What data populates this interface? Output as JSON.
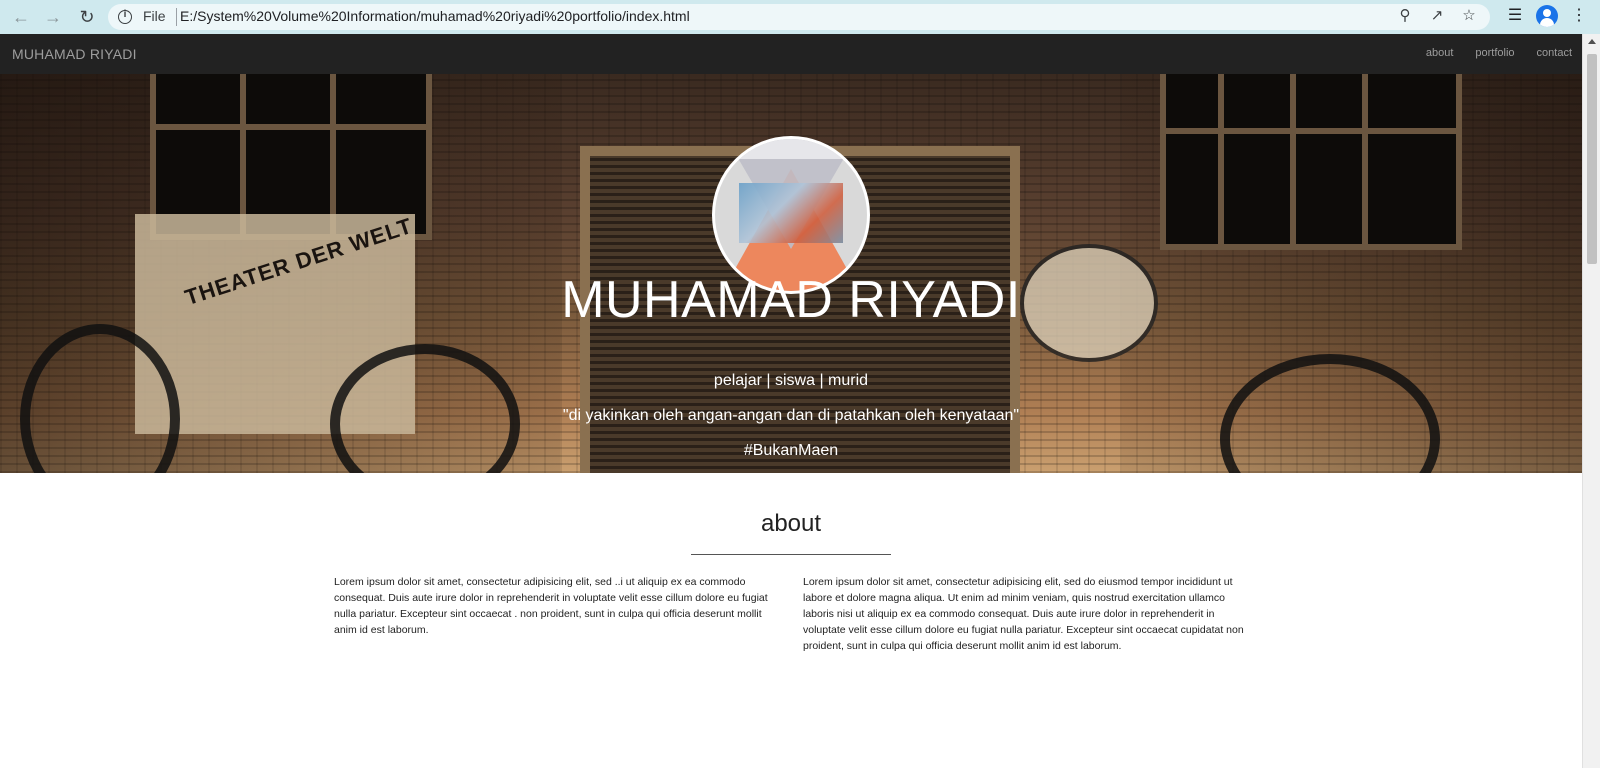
{
  "browser": {
    "file_label": "File",
    "url": "E:/System%20Volume%20Information/muhamad%20riyadi%20portfolio/index.html"
  },
  "site": {
    "brand": "MUHAMAD RIYADI",
    "nav": [
      {
        "label": "about"
      },
      {
        "label": "portfolio"
      },
      {
        "label": "contact"
      }
    ]
  },
  "hero": {
    "title": "MUHAMAD RIYADI",
    "subtitle": "pelajar | siswa | murid",
    "quote": "\"di yakinkan oleh angan-angan dan di patahkan oleh kenyataan\"",
    "tag": "#BukanMaen",
    "poster_text": "THEATER DER WELT"
  },
  "about": {
    "title": "about",
    "left_text": "Lorem ipsum dolor sit amet, consectetur adipisicing elit, sed ..i ut aliquip ex ea commodo consequat. Duis aute irure dolor in reprehenderit in voluptate velit esse cillum dolore eu fugiat nulla pariatur. Excepteur sint occaecat . non proident, sunt in culpa qui officia deserunt mollit anim id est laborum.",
    "right_text": "Lorem ipsum dolor sit amet, consectetur adipisicing elit, sed do eiusmod tempor incididunt ut labore et dolore magna aliqua. Ut enim ad minim veniam, quis nostrud exercitation ullamco laboris nisi ut aliquip ex ea commodo consequat. Duis aute irure dolor in reprehenderit in voluptate velit esse cillum dolore eu fugiat nulla pariatur. Excepteur sint occaecat cupidatat non proident, sunt in culpa qui officia deserunt mollit anim id est laborum."
  },
  "colors": {
    "navbar_bg": "#222222",
    "nav_text": "#9d9d9d",
    "chrome_bg": "#cfe9ee"
  }
}
